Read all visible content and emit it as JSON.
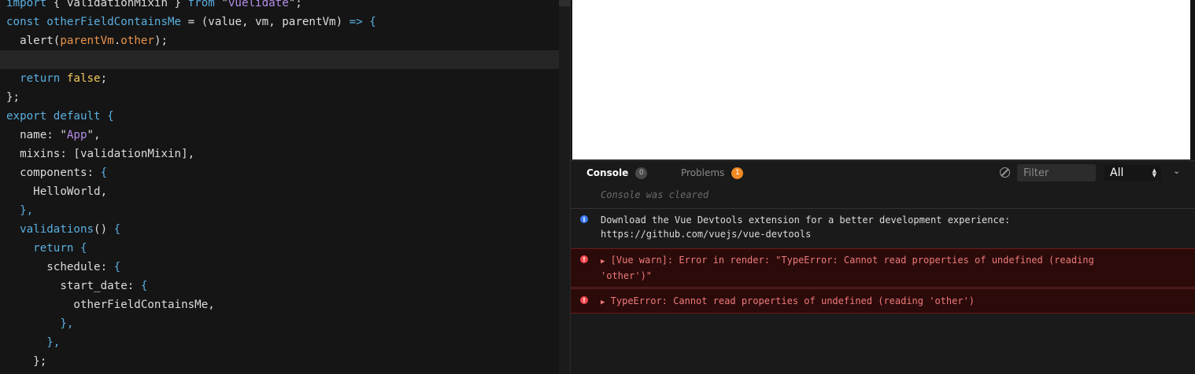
{
  "editor": {
    "lines": [
      [
        {
          "t": "import",
          "c": "kw"
        },
        {
          "t": " { validationMixin } ",
          "c": "id"
        },
        {
          "t": "from",
          "c": "kw"
        },
        {
          "t": " \"",
          "c": "id"
        },
        {
          "t": "vuelidate",
          "c": "str"
        },
        {
          "t": "\";",
          "c": "id"
        }
      ],
      [
        {
          "t": "const",
          "c": "kw"
        },
        {
          "t": " ",
          "c": "id"
        },
        {
          "t": "otherFieldContainsMe",
          "c": "fn"
        },
        {
          "t": " = (value, vm, parentVm) ",
          "c": "id"
        },
        {
          "t": "=>",
          "c": "kw"
        },
        {
          "t": " {",
          "c": "kw"
        }
      ],
      [
        {
          "t": "  alert(",
          "c": "id"
        },
        {
          "t": "parentVm",
          "c": "var"
        },
        {
          "t": ".",
          "c": "id"
        },
        {
          "t": "other",
          "c": "var"
        },
        {
          "t": ");",
          "c": "id"
        }
      ],
      [],
      [
        {
          "t": "  return ",
          "c": "kw"
        },
        {
          "t": "false",
          "c": "lit"
        },
        {
          "t": ";",
          "c": "id"
        }
      ],
      [
        {
          "t": "};",
          "c": "id"
        }
      ],
      [
        {
          "t": "export",
          "c": "kw"
        },
        {
          "t": " ",
          "c": "id"
        },
        {
          "t": "default",
          "c": "kw"
        },
        {
          "t": " {",
          "c": "kw"
        }
      ],
      [
        {
          "t": "  name: \"",
          "c": "id"
        },
        {
          "t": "App",
          "c": "str"
        },
        {
          "t": "\",",
          "c": "id"
        }
      ],
      [
        {
          "t": "  mixins: [validationMixin],",
          "c": "id"
        }
      ],
      [
        {
          "t": "  components: ",
          "c": "id"
        },
        {
          "t": "{",
          "c": "kw"
        }
      ],
      [
        {
          "t": "    HelloWorld,",
          "c": "id"
        }
      ],
      [
        {
          "t": "  },",
          "c": "kw"
        }
      ],
      [
        {
          "t": "  validations",
          "c": "fn"
        },
        {
          "t": "() ",
          "c": "id"
        },
        {
          "t": "{",
          "c": "kw"
        }
      ],
      [
        {
          "t": "    return ",
          "c": "kw"
        },
        {
          "t": "{",
          "c": "kw"
        }
      ],
      [
        {
          "t": "      schedule: ",
          "c": "id"
        },
        {
          "t": "{",
          "c": "kw"
        }
      ],
      [
        {
          "t": "        start_date: ",
          "c": "id"
        },
        {
          "t": "{",
          "c": "kw"
        }
      ],
      [
        {
          "t": "          otherFieldContainsMe,",
          "c": "id"
        }
      ],
      [
        {
          "t": "        },",
          "c": "kw"
        }
      ],
      [
        {
          "t": "      },",
          "c": "kw"
        }
      ],
      [
        {
          "t": "    };",
          "c": "id"
        }
      ]
    ],
    "active_line": 3
  },
  "console": {
    "tabs": [
      {
        "label": "Console",
        "count": "0"
      },
      {
        "label": "Problems",
        "count": "1"
      }
    ],
    "filter_placeholder": "Filter",
    "level": "All",
    "cleared_text": "Console was cleared",
    "info": {
      "line1": "Download the Vue Devtools extension for a better development experience:",
      "line2": "https://github.com/vuejs/vue-devtools"
    },
    "errors": [
      {
        "line1": "[Vue warn]: Error in render: \"TypeError: Cannot read properties of undefined (reading",
        "line2": "'other')\""
      },
      {
        "line1": "TypeError: Cannot read properties of undefined (reading 'other')"
      }
    ],
    "colors": {
      "accent_orange": "#f08a24",
      "error_text": "#f07a7a",
      "info_blue": "#3a7bf2"
    }
  }
}
